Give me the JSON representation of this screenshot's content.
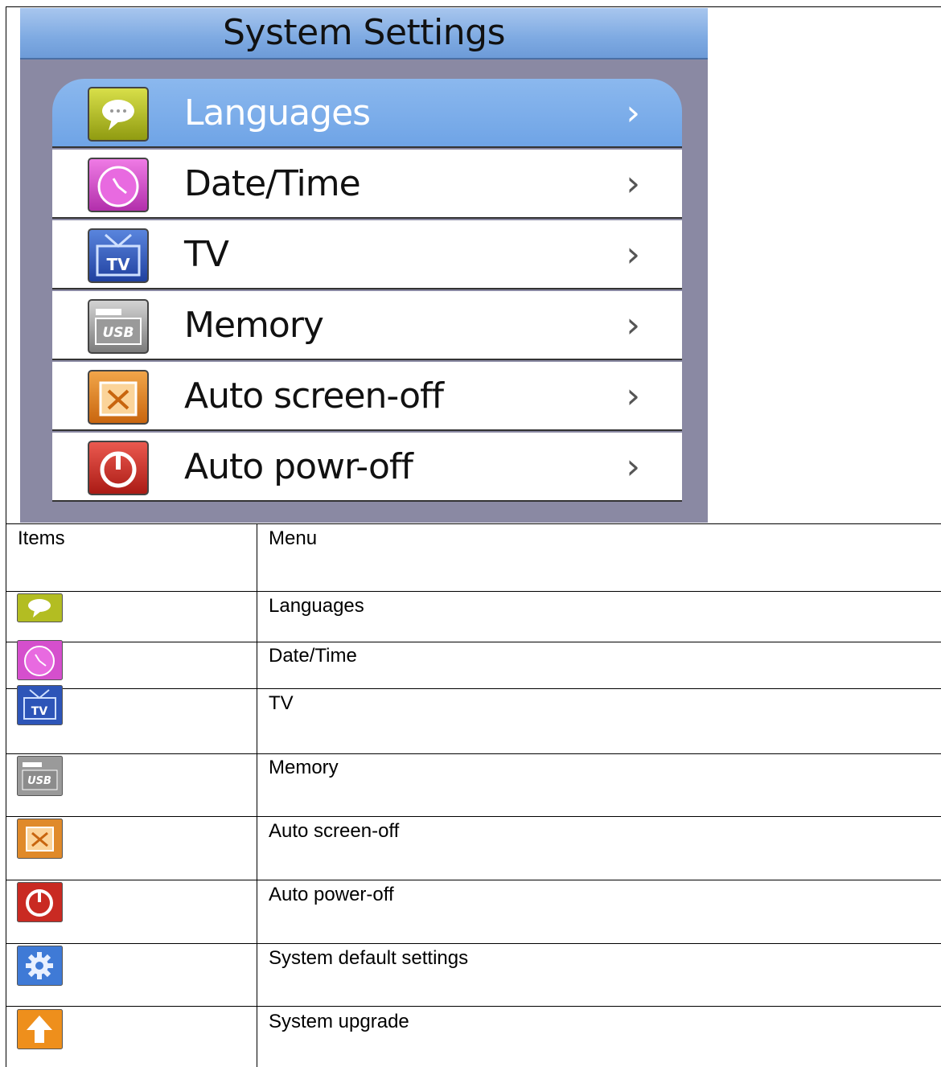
{
  "screen": {
    "title": "System Settings",
    "menu_items": [
      {
        "label": "Languages",
        "icon": "speech-bubble-icon",
        "selected": true
      },
      {
        "label": "Date/Time",
        "icon": "clock-icon"
      },
      {
        "label": "TV",
        "icon": "tv-icon"
      },
      {
        "label": "Memory",
        "icon": "usb-icon"
      },
      {
        "label": "Auto  screen-off",
        "icon": "screen-off-icon"
      },
      {
        "label": "Auto  powr-off",
        "icon": "power-icon"
      }
    ],
    "chevron": "›"
  },
  "table": {
    "headers": {
      "items": "Items",
      "menu": "Menu"
    },
    "rows": [
      {
        "icon": "speech-bubble-icon",
        "menu": "Languages"
      },
      {
        "icon": "clock-icon",
        "menu": "Date/Time"
      },
      {
        "icon": "tv-icon",
        "menu": "TV"
      },
      {
        "icon": "usb-icon",
        "menu": "Memory"
      },
      {
        "icon": "screen-off-icon",
        "menu": "Auto screen-off"
      },
      {
        "icon": "power-icon",
        "menu": "Auto power-off"
      },
      {
        "icon": "gear-icon",
        "menu": "System default settings"
      },
      {
        "icon": "upgrade-arrow-icon",
        "menu": "System upgrade"
      }
    ]
  },
  "colors": {
    "screen_bg": "#8a89a3",
    "title_bar": "#7eaae2",
    "selected_row": "#6fa4e6"
  }
}
